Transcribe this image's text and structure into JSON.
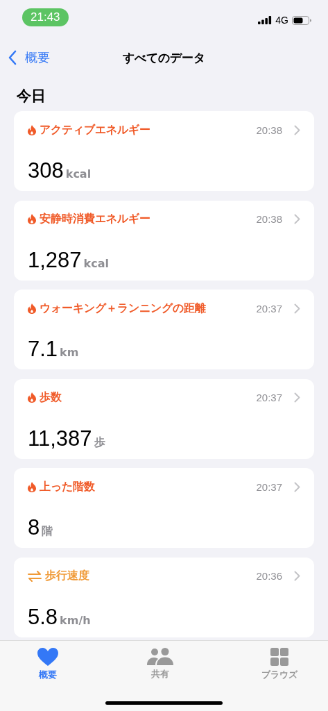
{
  "status_bar": {
    "time": "21:43",
    "network": "4G"
  },
  "nav": {
    "back": "概要",
    "title": "すべてのデータ"
  },
  "section": "今日",
  "cards": [
    {
      "kind": "flame",
      "color": "#f05a28",
      "title": "アクティブエネルギー",
      "time": "20:38",
      "value": "308",
      "unit": "kcal"
    },
    {
      "kind": "flame",
      "color": "#f05a28",
      "title": "安静時消費エネルギー",
      "time": "20:38",
      "value": "1,287",
      "unit": "kcal"
    },
    {
      "kind": "flame",
      "color": "#f05a28",
      "title": "ウォーキング＋ランニングの距離",
      "time": "20:37",
      "value": "7.1",
      "unit": "km"
    },
    {
      "kind": "flame",
      "color": "#f05a28",
      "title": "歩数",
      "time": "20:37",
      "value": "11,387",
      "unit": "歩"
    },
    {
      "kind": "flame",
      "color": "#f05a28",
      "title": "上った階数",
      "time": "20:37",
      "value": "8",
      "unit": "階"
    },
    {
      "kind": "arrows",
      "color": "#f09a37",
      "title": "歩行速度",
      "time": "20:36",
      "value": "5.8",
      "unit": "km/h"
    }
  ],
  "tabs": [
    {
      "kind": "heart",
      "label": "概要",
      "selected": true
    },
    {
      "kind": "people",
      "label": "共有",
      "selected": false
    },
    {
      "kind": "grid",
      "label": "ブラウズ",
      "selected": false
    }
  ]
}
